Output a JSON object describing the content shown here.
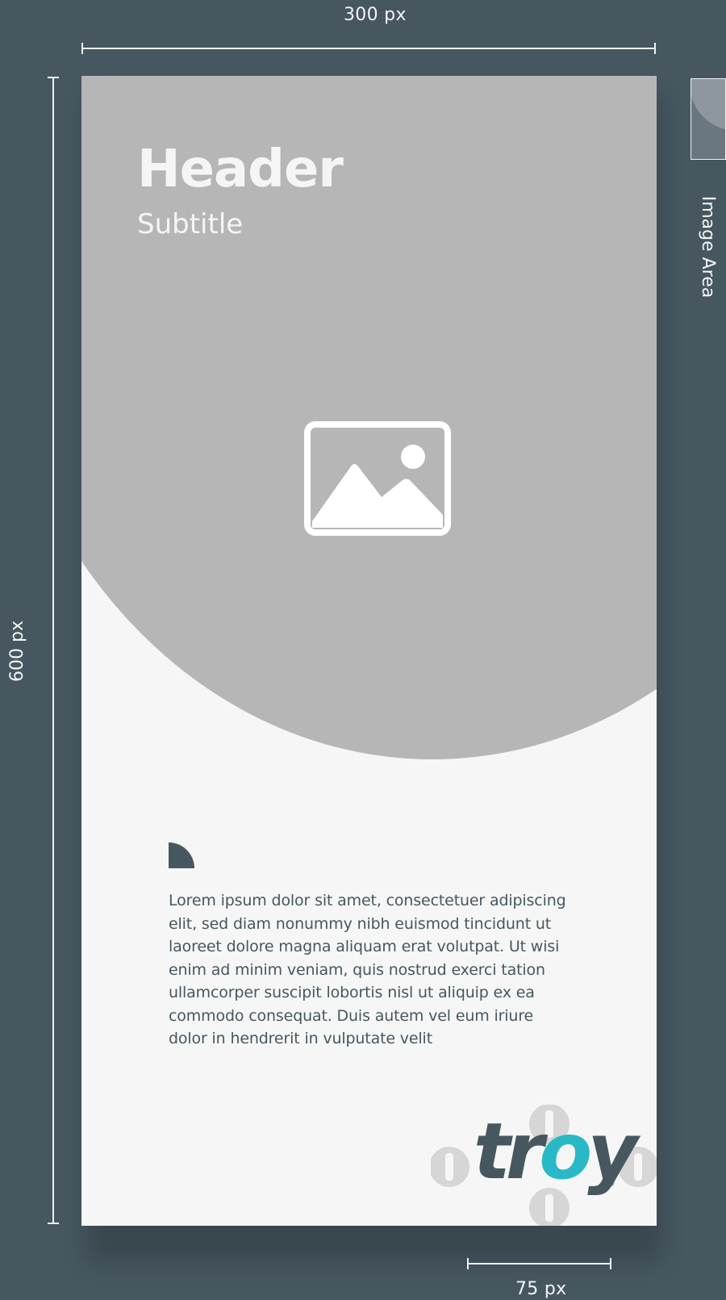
{
  "dimensions": {
    "width_label": "300 px",
    "height_label": "600 px",
    "bottom_label": "75 px",
    "image_area_label": "Image Area"
  },
  "card": {
    "title": "Header",
    "subtitle": "Subtitle",
    "body": "Lorem ipsum dolor sit amet, consectetuer adipiscing elit, sed diam nonummy nibh euismod tincidunt ut laoreet dolore magna aliquam erat volutpat. Ut wisi enim ad minim veniam, quis nostrud exerci tation ullamcorper suscipit lobortis nisl ut aliquip ex ea commodo consequat. Duis autem vel eum iriure dolor in hendrerit in vulputate velit",
    "image_icon": "image-placeholder-icon",
    "quote_icon": "quarter-circle-icon"
  },
  "logo": {
    "brand": "troy",
    "text_prefix": "tr",
    "text_accent": "o",
    "text_suffix": "y",
    "registered": "®",
    "accent_color": "#29b8c6",
    "main_color": "#465760"
  },
  "colors": {
    "background": "#465760",
    "card_background": "#f6f6f6",
    "hero": "#b6b6b6",
    "guide": "#eef2f3"
  }
}
